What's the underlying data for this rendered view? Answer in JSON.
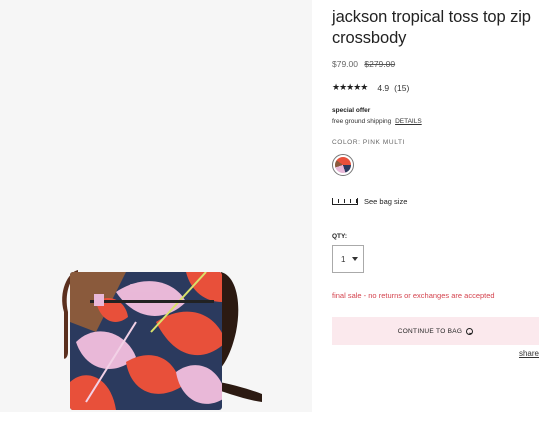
{
  "product": {
    "title": "jackson tropical toss top zip crossbody",
    "price": "$79.00",
    "original_price": "$279.00",
    "rating_stars": "★★★★★",
    "rating": "4.9",
    "review_count": "(15)"
  },
  "offer": {
    "title": "special offer",
    "text": "free ground shipping",
    "details_link": "DETAILS"
  },
  "color": {
    "label": "COLOR: PINK MULTI",
    "swatch_icon": "pink-multi-swatch"
  },
  "bag_size": {
    "label": "See bag size",
    "icon": "ruler-icon"
  },
  "quantity": {
    "label": "QTY:",
    "value": "1"
  },
  "final_sale": "final sale - no returns or exchanges are accepted",
  "cta": {
    "label": "CONTINUE TO BAG",
    "icon": "smile-icon"
  },
  "share": "share",
  "colors": {
    "cta_bg": "#fbe9ed",
    "sale_red": "#d4434e",
    "image_bg": "#f6f6f6"
  }
}
